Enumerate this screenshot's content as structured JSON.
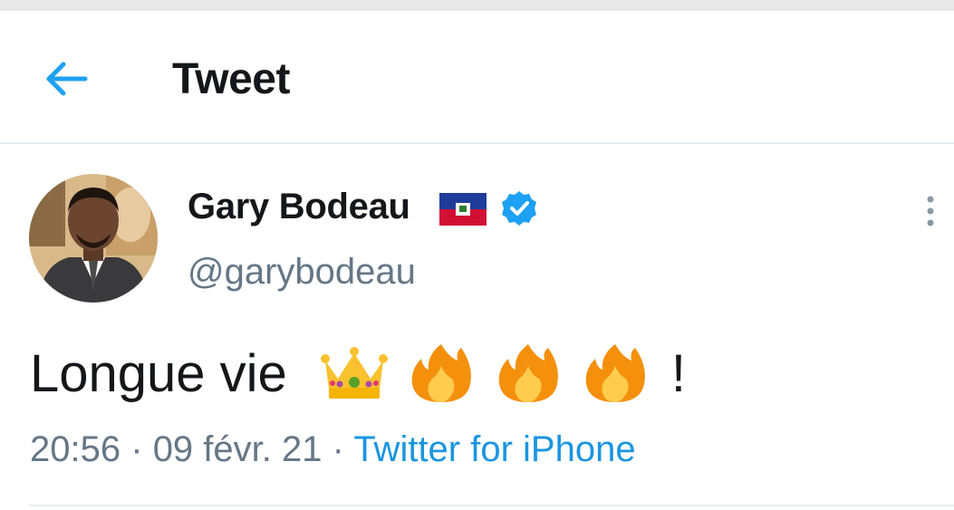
{
  "header": {
    "title": "Tweet",
    "back_icon": "arrow-left-icon"
  },
  "tweet": {
    "author": {
      "display_name": "Gary Bodeau",
      "handle": "@garybodeau",
      "flag_icon": "haiti-flag-icon",
      "verified_icon": "verified-badge-icon"
    },
    "text_start": "Longue vie",
    "emojis": [
      "crown-emoji",
      "fire-emoji",
      "fire-emoji",
      "fire-emoji"
    ],
    "text_end": "!",
    "time": "20:56",
    "separator": "·",
    "date": "09 févr. 21",
    "source": "Twitter for iPhone"
  },
  "colors": {
    "accent": "#1da1f2",
    "link": "#1b95e0",
    "text_primary": "#14171a",
    "text_secondary": "#657786",
    "divider": "#e6ecf0"
  }
}
